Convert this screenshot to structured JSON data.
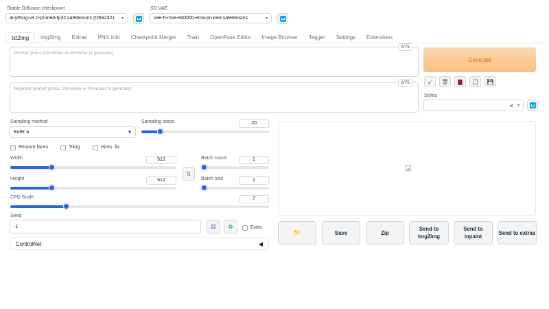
{
  "checkpoint": {
    "label": "Stable Diffusion checkpoint",
    "value": "anything-v4.0-pruned-fp32.safetensors [f28a2321"
  },
  "vae": {
    "label": "SD VAE",
    "value": "vae-ft-mse-840000-ema-pruned.safetensors"
  },
  "tabs": [
    {
      "label": "txt2img",
      "active": true
    },
    {
      "label": "img2img"
    },
    {
      "label": "Extras"
    },
    {
      "label": "PNG Info"
    },
    {
      "label": "Checkpoint Merger"
    },
    {
      "label": "Train"
    },
    {
      "label": "OpenPose Editor"
    },
    {
      "label": "Image Browser"
    },
    {
      "label": "Tagger"
    },
    {
      "label": "Settings"
    },
    {
      "label": "Extensions"
    }
  ],
  "prompt": {
    "placeholder": "Prompt (press Ctrl+Enter or Alt+Enter to generate)",
    "counter": "0/75"
  },
  "negative_prompt": {
    "placeholder": "Negative prompt (press Ctrl+Enter or Alt+Enter to generate)",
    "counter": "0/75"
  },
  "generate_label": "Generate",
  "styles": {
    "label": "Styles",
    "clear": "×"
  },
  "sampling_method": {
    "label": "Sampling method",
    "value": "Euler a"
  },
  "sampling_steps": {
    "label": "Sampling steps",
    "value": "20",
    "fraction": 0.13
  },
  "checkboxes": {
    "restore_faces": "Restore faces",
    "tiling": "Tiling",
    "hires_fix": "Hires. fix"
  },
  "width": {
    "label": "Width",
    "value": "512",
    "fraction": 0.24
  },
  "height": {
    "label": "Height",
    "value": "512",
    "fraction": 0.24
  },
  "batch_count": {
    "label": "Batch count",
    "value": "1",
    "fraction": 0.0
  },
  "batch_size": {
    "label": "Batch size",
    "value": "1",
    "fraction": 0.0
  },
  "cfg_scale": {
    "label": "CFG Scale",
    "value": "7",
    "fraction": 0.21
  },
  "seed": {
    "label": "Seed",
    "value": "-1",
    "extra": "Extra"
  },
  "controlnet": {
    "label": "ControlNet"
  },
  "actions": {
    "save": "Save",
    "zip": "Zip",
    "send_img2img": "Send to img2img",
    "send_inpaint": "Send to inpaint",
    "send_extras": "Send to extras"
  },
  "colors": {
    "accent": "#2563eb",
    "generate": "#fbbf80",
    "generate_text": "#ea580c",
    "icon_blue": "#0ea5e9"
  }
}
